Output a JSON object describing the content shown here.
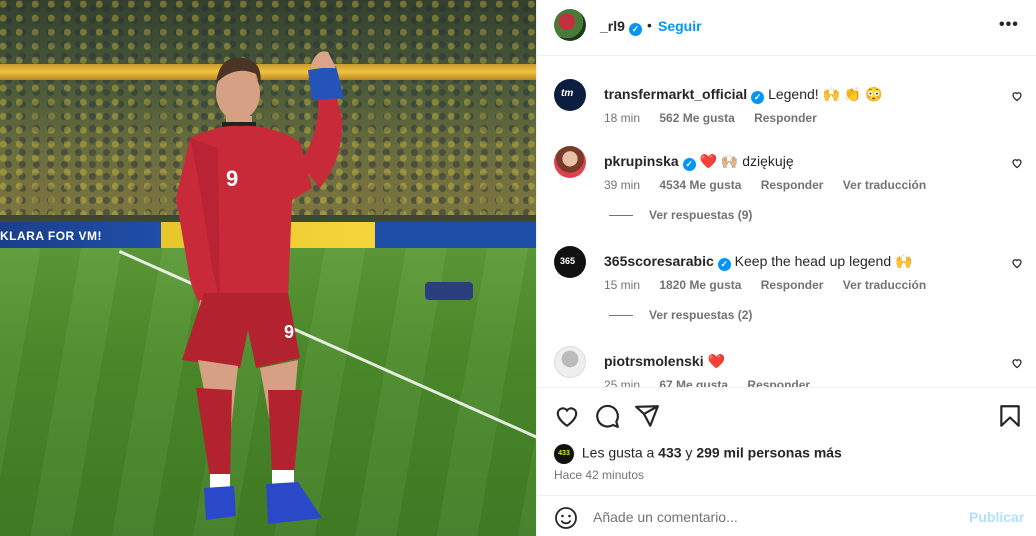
{
  "post": {
    "username": "_rl9",
    "follow_label": "Seguir",
    "dot": "•",
    "more_label": "•••",
    "photo_banner_text": "KLARA FOR VM!"
  },
  "comments": [
    {
      "user": "transfermarkt_official",
      "verified": true,
      "text": "Legend! 🙌 👏 😳",
      "time": "18 min",
      "likes": "562 Me gusta",
      "reply": "Responder",
      "translate": "",
      "avatar_text": "tm",
      "view_replies": ""
    },
    {
      "user": "pkrupinska",
      "verified": true,
      "text": "❤️ 🙌🏼 dziękuję",
      "time": "39 min",
      "likes": "4534 Me gusta",
      "reply": "Responder",
      "translate": "Ver traducción",
      "avatar_text": "",
      "view_replies": "Ver respuestas (9)"
    },
    {
      "user": "365scoresarabic",
      "verified": true,
      "text": "Keep the head up legend 🙌",
      "time": "15 min",
      "likes": "1820 Me gusta",
      "reply": "Responder",
      "translate": "Ver traducción",
      "avatar_text": "365",
      "view_replies": "Ver respuestas (2)"
    },
    {
      "user": "piotrsmolenski",
      "verified": false,
      "text": "❤️",
      "time": "25 min",
      "likes": "67 Me gusta",
      "reply": "Responder",
      "translate": "",
      "avatar_text": "",
      "view_replies": ""
    }
  ],
  "actions": {
    "icons": [
      "heart-icon",
      "comment-icon",
      "share-icon",
      "bookmark-icon"
    ],
    "likes_prefix": "Les gusta a",
    "likes_user": "433",
    "likes_and": "y",
    "likes_rest": "299 mil personas más",
    "mini_avatar_text": "433",
    "time_ago": "Hace 42 minutos"
  },
  "composer": {
    "placeholder": "Añade un comentario...",
    "publish_label": "Publicar"
  },
  "colors": {
    "accent": "#0095f6",
    "publish_disabled": "#b2dffc",
    "like_red": "#ff3040",
    "secondary_text": "#737373"
  }
}
